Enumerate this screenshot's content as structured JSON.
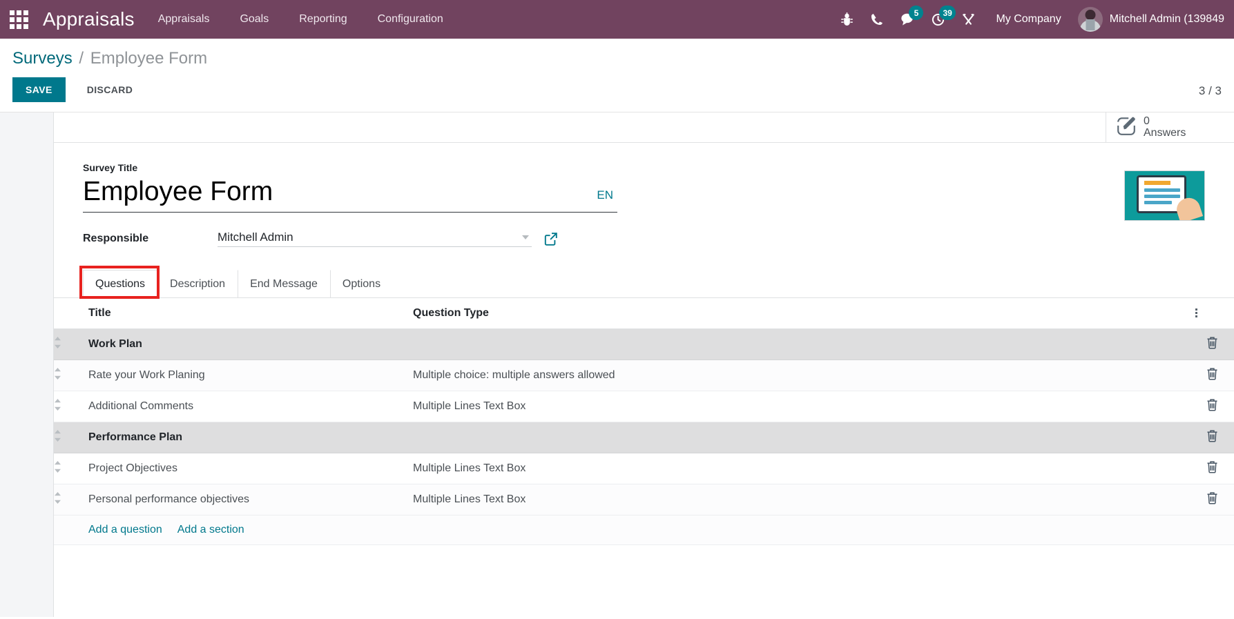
{
  "navbar": {
    "apps_icon": "grid-apps-icon",
    "brand": "Appraisals",
    "menu": [
      {
        "label": "Appraisals"
      },
      {
        "label": "Goals"
      },
      {
        "label": "Reporting"
      },
      {
        "label": "Configuration"
      }
    ],
    "icons": [
      {
        "name": "bug-icon",
        "badge": ""
      },
      {
        "name": "phone-icon",
        "badge": ""
      },
      {
        "name": "chat-icon",
        "badge": "5"
      },
      {
        "name": "activity-clock-icon",
        "badge": "39"
      },
      {
        "name": "tools-icon",
        "badge": ""
      }
    ],
    "company": "My Company",
    "user": "Mitchell Admin (139849",
    "accent_color": "#00838f",
    "background_color": "#71435f"
  },
  "control_panel": {
    "breadcrumb_root": "Surveys",
    "breadcrumb_separator": "/",
    "breadcrumb_current": "Employee Form",
    "save_label": "SAVE",
    "discard_label": "DISCARD",
    "pager": "3 / 3",
    "save_color": "#00788c"
  },
  "stat_buttons": [
    {
      "icon": "pencil-square-icon",
      "value": "0",
      "label": "Answers"
    }
  ],
  "form": {
    "title_label": "Survey Title",
    "title_value": "Employee Form",
    "language_badge": "EN",
    "responsible_label": "Responsible",
    "responsible_value": "Mitchell Admin",
    "internal_link_icon": "external-link-icon",
    "dropdown_icon": "chevron-down-icon",
    "thumbnail_icon": "survey-tablet-image"
  },
  "tabs": [
    {
      "label": "Questions",
      "active": true,
      "highlighted": true
    },
    {
      "label": "Description",
      "active": false,
      "highlighted": false
    },
    {
      "label": "End Message",
      "active": false,
      "highlighted": false
    },
    {
      "label": "Options",
      "active": false,
      "highlighted": false
    }
  ],
  "highlight_color": "#e8221f",
  "questions_table": {
    "columns": [
      "Title",
      "Question Type"
    ],
    "options_icon": "column-options-icon",
    "rows": [
      {
        "kind": "section",
        "title": "Work Plan",
        "type": "",
        "handle": "drag-handle-icon",
        "delete": "trash-icon"
      },
      {
        "kind": "question",
        "title": "Rate your Work Planing",
        "type": "Multiple choice: multiple answers allowed",
        "handle": "drag-handle-icon",
        "delete": "trash-icon"
      },
      {
        "kind": "question",
        "title": "Additional Comments",
        "type": "Multiple Lines Text Box",
        "handle": "drag-handle-icon",
        "delete": "trash-icon"
      },
      {
        "kind": "section",
        "title": "Performance Plan",
        "type": "",
        "handle": "drag-handle-icon",
        "delete": "trash-icon"
      },
      {
        "kind": "question",
        "title": "Project Objectives",
        "type": "Multiple Lines Text Box",
        "handle": "drag-handle-icon",
        "delete": "trash-icon"
      },
      {
        "kind": "question",
        "title": "Personal performance objectives",
        "type": "Multiple Lines Text Box",
        "handle": "drag-handle-icon",
        "delete": "trash-icon"
      }
    ],
    "add_question_label": "Add a question",
    "add_section_label": "Add a section"
  }
}
